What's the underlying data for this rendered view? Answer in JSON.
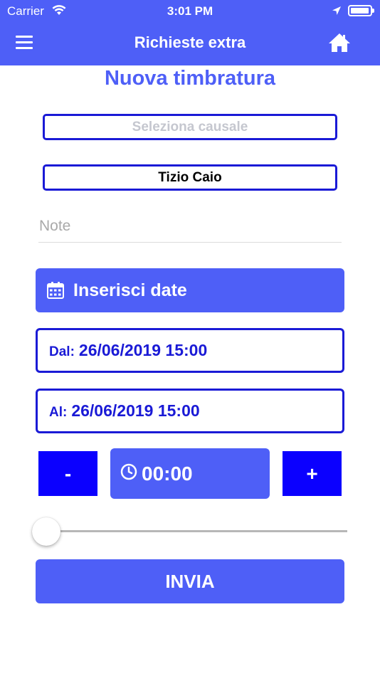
{
  "status_bar": {
    "carrier": "Carrier",
    "time": "3:01 PM"
  },
  "nav": {
    "title": "Richieste extra",
    "menu_icon": "hamburger-menu-icon",
    "home_icon": "home-icon"
  },
  "form": {
    "title": "Nuova timbratura",
    "causale_placeholder": "Seleziona causale",
    "person_value": "Tizio Caio",
    "note_placeholder": "Note",
    "dates_button_label": "Inserisci date",
    "from_label": "Dal:",
    "from_value": "26/06/2019 15:00",
    "to_label": "Al:",
    "to_value": "26/06/2019 15:00",
    "decrement_label": "-",
    "increment_label": "+",
    "duration_value": "00:00",
    "slider_value": 0,
    "submit_label": "INVIA"
  },
  "colors": {
    "primary": "#4e5ff7",
    "accent_blue": "#1a1ad6",
    "stepper_blue": "#0b00ff"
  }
}
